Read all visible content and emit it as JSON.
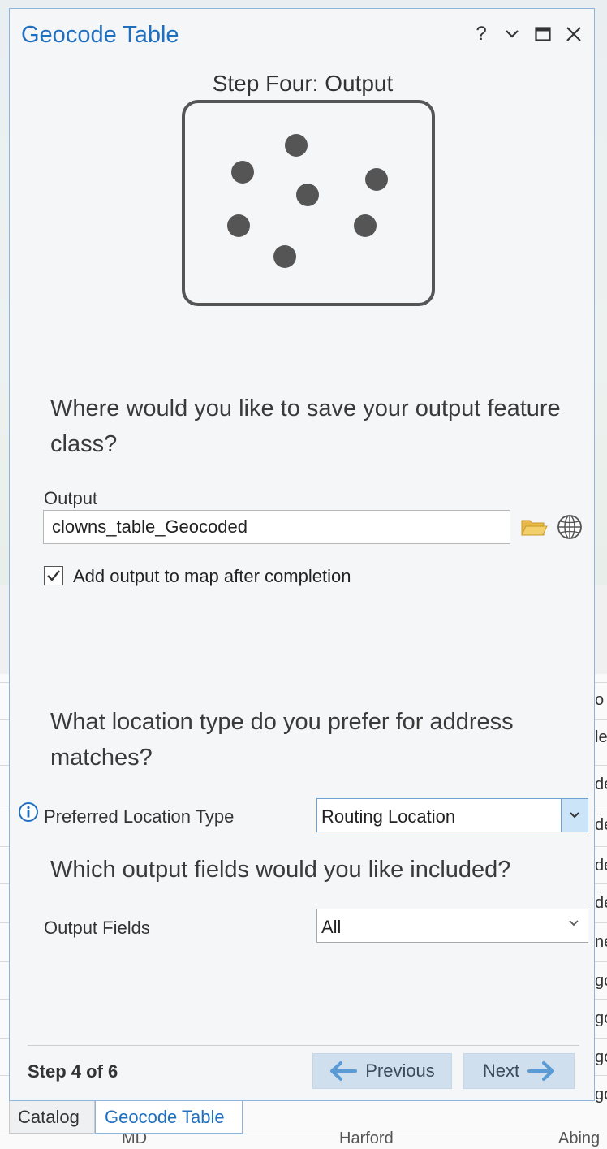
{
  "background_table": {
    "cell_fragments": [
      "o",
      "le",
      "de",
      "de",
      "de",
      "de",
      "ne",
      "go",
      "go",
      "go",
      "go"
    ],
    "bottom_row": [
      "MD",
      "Harford",
      "Abing"
    ]
  },
  "pane": {
    "title": "Geocode Table",
    "controls": {
      "help": "?",
      "options": "options",
      "maximize": "maximize",
      "close": "close"
    }
  },
  "step": {
    "heading": "Step Four: Output",
    "illustration_icon": "point-features-icon"
  },
  "output_section": {
    "question": "Where would you like to save your output feature class?",
    "label": "Output",
    "value": "clowns_table_Geocoded",
    "browse_icon": "folder-icon",
    "portal_icon": "globe-icon",
    "add_to_map_checked": true,
    "add_to_map_label": "Add output to map after completion"
  },
  "location_section": {
    "question": "What location type do you prefer for address matches?",
    "label": "Preferred Location Type",
    "value": "Routing Location",
    "info_icon": "info-icon"
  },
  "fields_section": {
    "question": "Which output fields would you like included?",
    "label": "Output Fields",
    "value": "All"
  },
  "footer": {
    "step_count": "Step 4 of 6",
    "previous_label": "Previous",
    "next_label": "Next"
  },
  "tabs": [
    {
      "label": "Catalog",
      "active": false
    },
    {
      "label": "Geocode Table",
      "active": true
    }
  ],
  "colors": {
    "accent": "#1f6fbf",
    "button_bg": "#cfdfee",
    "arrow": "#5a9bd5"
  }
}
